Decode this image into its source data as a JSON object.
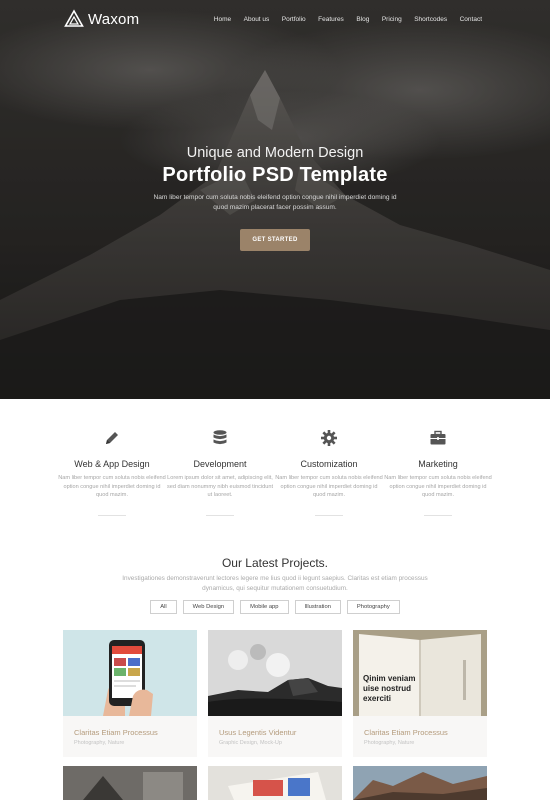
{
  "brand": {
    "name": "Waxom"
  },
  "nav": {
    "items": [
      "Home",
      "About us",
      "Portfolio",
      "Features",
      "Blog",
      "Pricing",
      "Shortcodes",
      "Contact"
    ]
  },
  "hero": {
    "subtitle": "Unique and Modern Design",
    "title": "Portfolio PSD Template",
    "description": "Nam liber tempor cum soluta nobis eleifend option congue nihil imperdiet doming id quod mazim placerat facer possim assum.",
    "button": "GET STARTED"
  },
  "features": [
    {
      "icon": "pencil-icon",
      "title": "Web & App Design",
      "text": "Nam liber tempor cum soluta nobis eleifend option congue nihil imperdiet doming id quod mazim."
    },
    {
      "icon": "database-icon",
      "title": "Development",
      "text": "Lorem ipsum dolor sit amet, adipiscing elit, sed diam nonummy nibh euismod tincidunt ut laoreet."
    },
    {
      "icon": "gear-icon",
      "title": "Customization",
      "text": "Nam liber tempor cum soluta nobis eleifend option congue nihil imperdiet doming id quod mazim."
    },
    {
      "icon": "briefcase-icon",
      "title": "Marketing",
      "text": "Nam liber tempor cum soluta nobis eleifend option congue nihil imperdiet doming id quod mazim."
    }
  ],
  "projects": {
    "title": "Our Latest Projects.",
    "description": "Investigationes demonstraverunt lectores legere me lius quod ii legunt saepius. Claritas est etiam processus dynamicus, qui sequitur mutationem consuetudium.",
    "filters": [
      "All",
      "Web Design",
      "Mobile app",
      "Illustration",
      "Photography"
    ],
    "cards": [
      {
        "title": "Claritas Etiam Processus",
        "category": "Photography, Nature"
      },
      {
        "title": "Usus Legentis Videntur",
        "category": "Graphic Design, Mock-Up"
      },
      {
        "title": "Claritas Etiam Processus",
        "category": "Photography, Nature"
      }
    ],
    "book_text": "Qinim veniam uise nostrud exerciti"
  },
  "colors": {
    "accent": "#9b8369",
    "card_title": "#b49b7c",
    "hero_dark": "#2f2d2b"
  }
}
